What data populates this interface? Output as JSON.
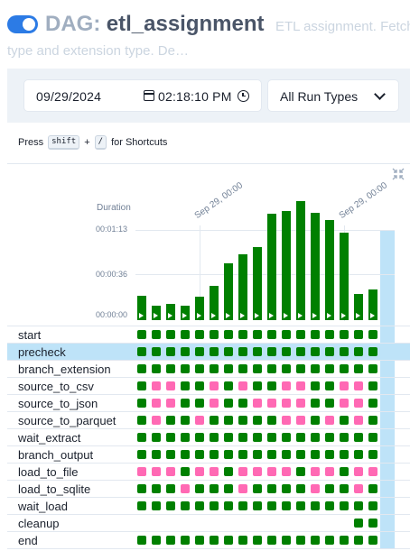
{
  "header": {
    "dag_prefix": "DAG:",
    "dag_id": "etl_assignment",
    "description_line1": "ETL assignment. Fetch d",
    "description_line2": "type and extension type. De…",
    "paused": false
  },
  "filters": {
    "date": "09/29/2024",
    "time": "02:18:10 PM",
    "run_type": "All Run Types"
  },
  "shortcuts": {
    "press": "Press",
    "key1": "shift",
    "plus": "+",
    "key2": "/",
    "suffix": "for Shortcuts"
  },
  "chart_data": {
    "type": "bar",
    "ylabel": "Duration",
    "y_ticks": [
      "00:00:00",
      "00:00:36",
      "00:01:13"
    ],
    "date_markers": [
      "Sep 29, 00:00",
      "Sep 29, 00:00"
    ],
    "values_seconds": [
      20,
      12,
      13,
      12,
      19,
      28,
      46,
      53,
      59,
      86,
      88,
      96,
      87,
      81,
      71,
      21,
      25
    ],
    "highlighted_run_index": 16
  },
  "tasks": [
    {
      "name": "start",
      "states": "sssssssssssssssss"
    },
    {
      "name": "precheck",
      "states": "sssssssssssssssss",
      "selected": true
    },
    {
      "name": "branch_extension",
      "states": "sssssssssssssssss"
    },
    {
      "name": "source_to_csv",
      "states": "sppsspspssppsspps"
    },
    {
      "name": "source_to_json",
      "states": "sppsspssppppsspps"
    },
    {
      "name": "source_to_parquet",
      "states": "spsspsssssppspsps"
    },
    {
      "name": "wait_extract",
      "states": "sssssssssssssssss"
    },
    {
      "name": "branch_output",
      "states": "sssssssssssssssss"
    },
    {
      "name": "load_to_file",
      "states": "pppsppsppppsppspp"
    },
    {
      "name": "load_to_sqlite",
      "states": "ssspssspsssspsspss"
    },
    {
      "name": "wait_load",
      "states": "sssssssssssssssss"
    },
    {
      "name": "cleanup",
      "states": "_______________ss"
    },
    {
      "name": "end",
      "states": "sssssssssssssssss"
    }
  ],
  "colors": {
    "success": "#008000",
    "skipped": "#ff69b4",
    "accent": "#2c7be5",
    "selected": "#bee3f8"
  }
}
